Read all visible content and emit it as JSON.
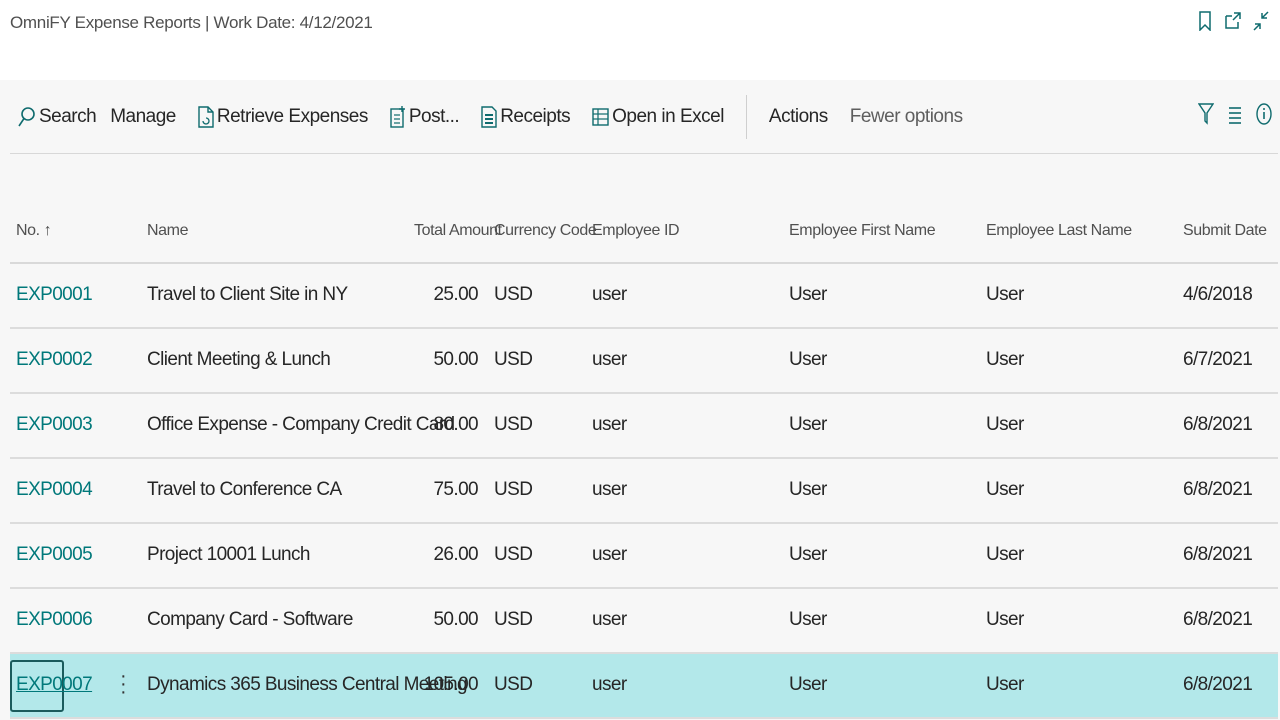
{
  "window": {
    "title": "OmniFY Expense Reports | Work Date: 4/12/2021",
    "icons": [
      "bookmark-icon",
      "open-new-window-icon",
      "collapse-icon"
    ]
  },
  "actions": {
    "search": "Search",
    "manage": "Manage",
    "retrieve": "Retrieve Expenses",
    "post": "Post...",
    "receipts": "Receipts",
    "excel": "Open in Excel",
    "actions": "Actions",
    "fewer": "Fewer options"
  },
  "columns": {
    "no": "No.",
    "name": "Name",
    "total": "Total Amount",
    "currency": "Currency Code",
    "employee_id": "Employee ID",
    "first": "Employee First Name",
    "last": "Employee Last Name",
    "submit": "Submit Date"
  },
  "rows": [
    {
      "no": "EXP0001",
      "name": "Travel to Client Site in NY",
      "total": "25.00",
      "currency": "USD",
      "employee_id": "user",
      "first": "User",
      "last": "User",
      "submit": "4/6/2018"
    },
    {
      "no": "EXP0002",
      "name": "Client Meeting & Lunch",
      "total": "50.00",
      "currency": "USD",
      "employee_id": "user",
      "first": "User",
      "last": "User",
      "submit": "6/7/2021"
    },
    {
      "no": "EXP0003",
      "name": "Office Expense - Company Credit Card",
      "total": "80.00",
      "currency": "USD",
      "employee_id": "user",
      "first": "User",
      "last": "User",
      "submit": "6/8/2021"
    },
    {
      "no": "EXP0004",
      "name": "Travel to Conference CA",
      "total": "75.00",
      "currency": "USD",
      "employee_id": "user",
      "first": "User",
      "last": "User",
      "submit": "6/8/2021"
    },
    {
      "no": "EXP0005",
      "name": "Project 10001 Lunch",
      "total": "26.00",
      "currency": "USD",
      "employee_id": "user",
      "first": "User",
      "last": "User",
      "submit": "6/8/2021"
    },
    {
      "no": "EXP0006",
      "name": "Company Card - Software",
      "total": "50.00",
      "currency": "USD",
      "employee_id": "user",
      "first": "User",
      "last": "User",
      "submit": "6/8/2021"
    },
    {
      "no": "EXP0007",
      "name": "Dynamics 365 Business Central Meeting",
      "total": "105.00",
      "currency": "USD",
      "employee_id": "user",
      "first": "User",
      "last": "User",
      "submit": "6/8/2021"
    }
  ],
  "colors": {
    "link": "#00787a",
    "selected_row": "#b3e8ea",
    "icon": "#0f6b6e"
  }
}
